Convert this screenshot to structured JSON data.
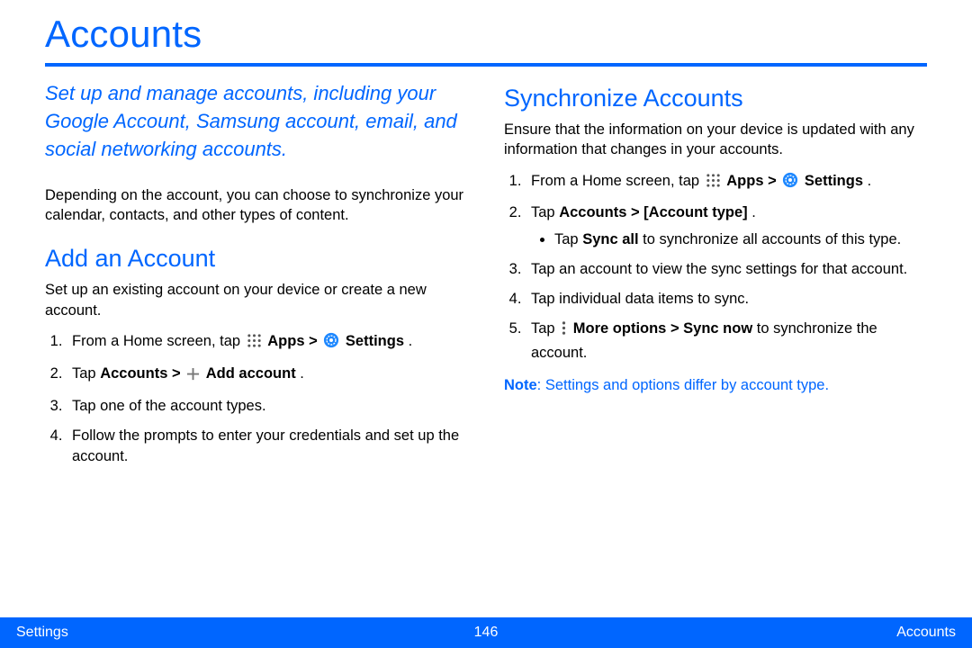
{
  "title": "Accounts",
  "intro": "Set up and manage accounts, including your Google Account, Samsung account, email, and social networking accounts.",
  "paragraph1": "Depending on the account, you can choose to synchronize your calendar, contacts, and other types of content.",
  "sections": {
    "add": {
      "heading": "Add an Account",
      "lead": "Set up an existing account on your device or create a new account.",
      "steps": {
        "s1_a": "From a Home screen, tap ",
        "s1_b": "Apps > ",
        "s1_c": "Settings",
        "s1_d": " .",
        "s2_a": "Tap ",
        "s2_b": "Accounts > ",
        "s2_c": "Add account",
        "s2_d": ".",
        "s3": "Tap one of the account types.",
        "s4": "Follow the prompts to enter your credentials and set up the account."
      }
    },
    "sync": {
      "heading": "Synchronize Accounts",
      "lead": "Ensure that the information on your device is updated with any information that changes in your accounts.",
      "steps": {
        "s1_a": "From a Home screen, tap ",
        "s1_b": "Apps > ",
        "s1_c": "Settings",
        "s1_d": " .",
        "s2_a": "Tap ",
        "s2_b": "Accounts > [Account type]",
        "s2_c": ".",
        "b1_a": "Tap ",
        "b1_b": "Sync all",
        "b1_c": " to synchronize all accounts of this type.",
        "s3": "Tap an account to view the sync settings for that account.",
        "s4": "Tap individual data items to sync.",
        "s5_a": "Tap ",
        "s5_b": "More options > Sync now",
        "s5_c": " to synchronize the account."
      },
      "note_label": "Note",
      "note_text": ": Settings and options differ by account type."
    }
  },
  "footer": {
    "left": "Settings",
    "center": "146",
    "right": "Accounts"
  },
  "icons": {
    "apps": "apps-grid-icon",
    "settings": "settings-gear-icon",
    "plus": "plus-icon",
    "more": "more-vert-icon"
  }
}
